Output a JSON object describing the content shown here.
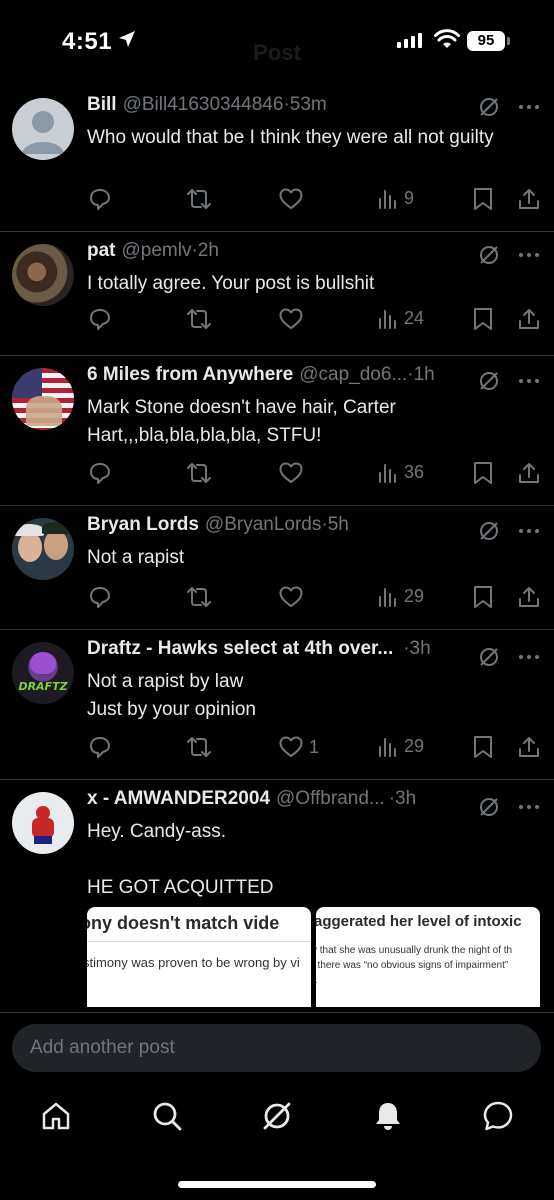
{
  "status_bar": {
    "time": "4:51",
    "battery": "95",
    "ghost_title": "Post"
  },
  "posts": [
    {
      "name": "Bill",
      "handle": "@Bill41630344846",
      "time": "·53m",
      "text": "Who would that be I think they were all not guilty",
      "views": "9",
      "likes": "",
      "avatar": "default-avatar"
    },
    {
      "name": "pat",
      "handle": "@pemlv",
      "time": "·2h",
      "text": "I totally agree. Your post is bullshit",
      "views": "24",
      "likes": "",
      "avatar": "photo-avatar"
    },
    {
      "name": "6 Miles from Anywhere",
      "handle": "@cap_do6...",
      "time": "·1h",
      "text": "Mark Stone doesn't have hair, Carter Hart,,,bla,bla,bla,bla, STFU!",
      "views": "36",
      "likes": "",
      "avatar": "flag-avatar"
    },
    {
      "name": "Bryan Lords",
      "handle": "@BryanLords",
      "time": "·5h",
      "text": "Not a rapist",
      "views": "29",
      "likes": "",
      "avatar": "couple-avatar"
    },
    {
      "name": "Draftz - Hawks select at 4th over...",
      "handle": "",
      "time": "·3h",
      "text": "Not a rapist by law\nJust by your opinion",
      "views": "29",
      "likes": "1",
      "avatar": "draftz-logo",
      "avatar_text": "DRAFTZ"
    },
    {
      "name": "x - AMWANDER2004",
      "handle": "@Offbrand...",
      "time": "·3h",
      "text": "Hey. Candy-ass.\n\nHE GOT ACQUITTED",
      "views": "",
      "likes": "",
      "avatar": "hockey-avatar"
    }
  ],
  "media": [
    {
      "headline": "nony doesn't match vide",
      "body": "stimony was proven to be wrong by vi"
    },
    {
      "headline": "aggerated her level of intoxic",
      "body": "y that she was unusually drunk the night of th\n, there was “no obvious signs of impairment”\nr."
    }
  ],
  "composer": {
    "placeholder": "Add another post"
  },
  "tabbar": {
    "items": [
      "home-icon",
      "search-icon",
      "grok-icon",
      "notifications-icon",
      "messages-icon"
    ]
  },
  "colors": {
    "background": "#000000",
    "text": "#e7e9ea",
    "muted": "#71767b",
    "divider": "#2f3336"
  }
}
